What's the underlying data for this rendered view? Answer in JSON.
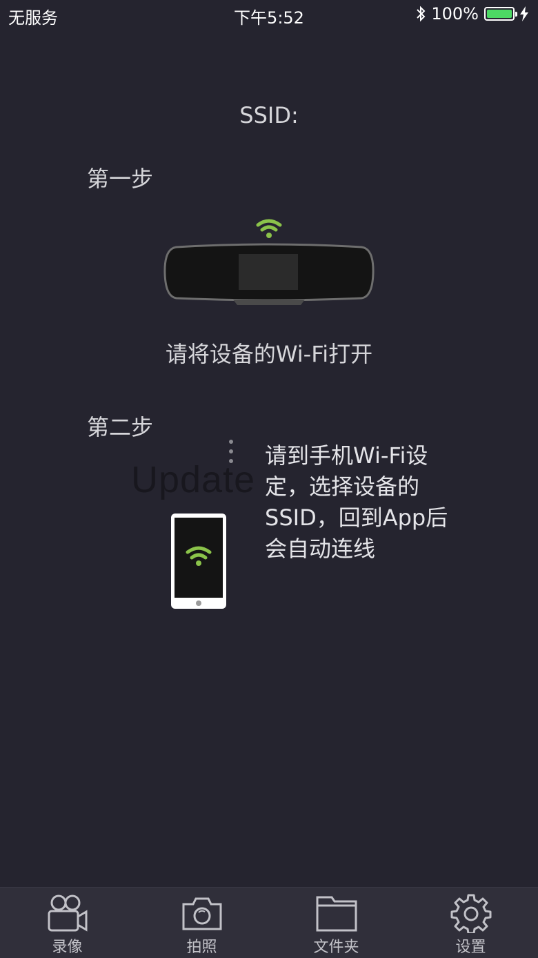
{
  "status_bar": {
    "carrier": "无服务",
    "time": "下午5:52",
    "battery_text": "100%",
    "battery_level": 1.0,
    "battery_color": "#4cd964",
    "bluetooth_icon": "bluetooth-icon",
    "charging_icon": "charging-bolt-icon"
  },
  "ssid_label": "SSID:",
  "step1": {
    "title": "第一步",
    "instruction": "请将设备的Wi-Fi打开",
    "icon": "rearview-mirror-device-icon"
  },
  "step2": {
    "title": "第二步",
    "instruction": "请到手机Wi-Fi设定，选择设备的SSID，回到App后会自动连线",
    "icon": "phone-wifi-icon"
  },
  "watermark": "Update",
  "accent_color": "#8bc34a",
  "tabs": [
    {
      "label": "录像",
      "icon": "video-camera-icon"
    },
    {
      "label": "拍照",
      "icon": "camera-icon"
    },
    {
      "label": "文件夹",
      "icon": "folder-icon"
    },
    {
      "label": "设置",
      "icon": "gear-icon"
    }
  ]
}
